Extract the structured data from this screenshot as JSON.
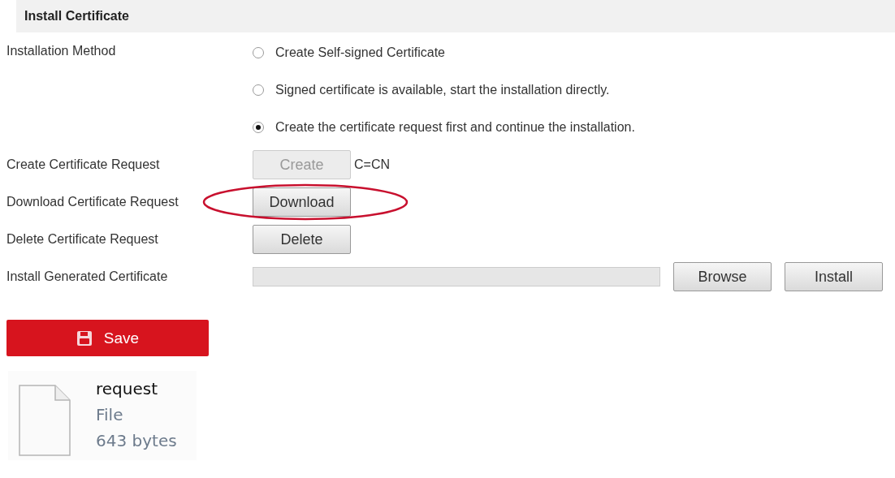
{
  "section": {
    "title": "Install Certificate"
  },
  "installation_method": {
    "label": "Installation Method",
    "options": [
      {
        "label": "Create Self-signed Certificate",
        "selected": false
      },
      {
        "label": "Signed certificate is available, start the installation directly.",
        "selected": false
      },
      {
        "label": "Create the certificate request first and continue the installation.",
        "selected": true
      }
    ]
  },
  "rows": [
    {
      "kind": "button",
      "label": "Create Certificate Request",
      "button": {
        "label": "Create",
        "disabled": true
      },
      "note": "C=CN",
      "highlighted": false
    },
    {
      "kind": "button",
      "label": "Download Certificate Request",
      "button": {
        "label": "Download",
        "disabled": false
      },
      "highlighted": true
    },
    {
      "kind": "button",
      "label": "Delete Certificate Request",
      "button": {
        "label": "Delete",
        "disabled": false
      },
      "highlighted": false
    },
    {
      "kind": "file",
      "label": "Install Generated Certificate",
      "buttons": [
        "Browse",
        "Install"
      ]
    }
  ],
  "save_button": {
    "label": "Save"
  },
  "file_tile": {
    "name": "request",
    "type": "File",
    "size": "643 bytes"
  }
}
